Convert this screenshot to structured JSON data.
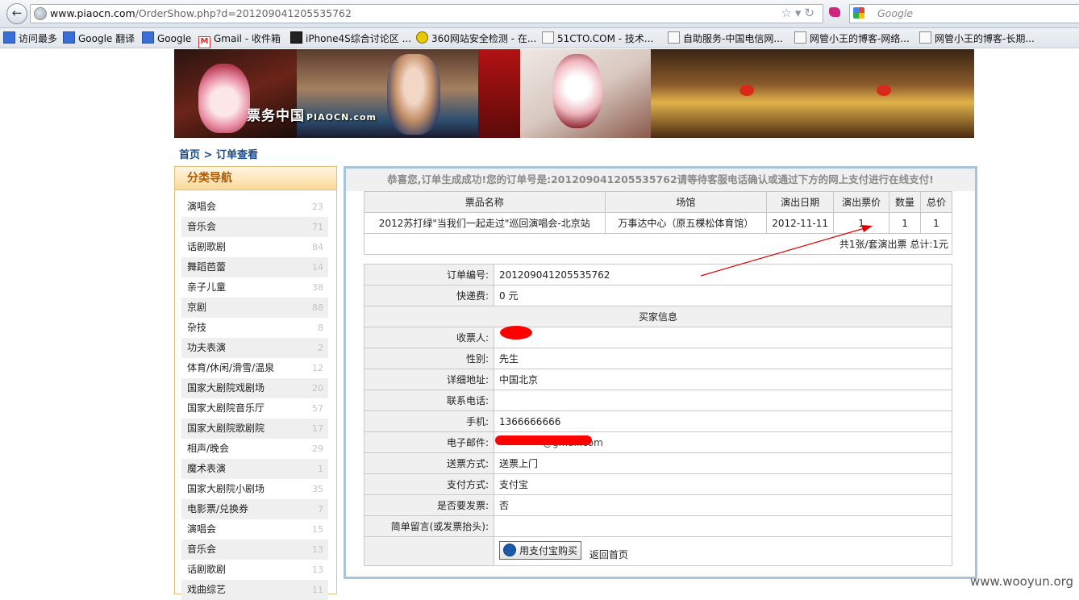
{
  "browser": {
    "url_prefix": "www.piaocn.com",
    "url_path": "/OrderShow.php?d=201209041205535762",
    "search_placeholder": "Google"
  },
  "bookmarks": [
    {
      "label": "访问最多"
    },
    {
      "label": "Google 翻译"
    },
    {
      "label": "Google"
    },
    {
      "label": "Gmail - 收件箱"
    },
    {
      "label": "iPhone4S综合讨论区 ..."
    },
    {
      "label": "360网站安全检测 - 在..."
    },
    {
      "label": "51CTO.COM - 技术..."
    },
    {
      "label": "自助服务-中国电信网..."
    },
    {
      "label": "网管小王的博客-网络..."
    },
    {
      "label": "网管小王的博客-长期..."
    }
  ],
  "banner": {
    "logo_text": "票务中国",
    "logo_sub": "PIAOCN.com"
  },
  "breadcrumb": {
    "home": "首页",
    "sep": " > ",
    "current": "订单查看"
  },
  "sidebar": {
    "title": "分类导航",
    "items": [
      {
        "label": "演唱会",
        "count": "23"
      },
      {
        "label": "音乐会",
        "count": "71"
      },
      {
        "label": "话剧歌剧",
        "count": "84"
      },
      {
        "label": "舞蹈芭蕾",
        "count": "14"
      },
      {
        "label": "亲子儿童",
        "count": "38"
      },
      {
        "label": "京剧",
        "count": "88"
      },
      {
        "label": "杂技",
        "count": "8"
      },
      {
        "label": "功夫表演",
        "count": "2"
      },
      {
        "label": "体育/休闲/滑雪/温泉",
        "count": "12"
      },
      {
        "label": "国家大剧院戏剧场",
        "count": "20"
      },
      {
        "label": "国家大剧院音乐厅",
        "count": "57"
      },
      {
        "label": "国家大剧院歌剧院",
        "count": "17"
      },
      {
        "label": "相声/晚会",
        "count": "29"
      },
      {
        "label": "魔术表演",
        "count": "1"
      },
      {
        "label": "国家大剧院小剧场",
        "count": "35"
      },
      {
        "label": "电影票/兑换券",
        "count": "7"
      },
      {
        "label": "演唱会",
        "count": "15"
      },
      {
        "label": "音乐会",
        "count": "13"
      },
      {
        "label": "话剧歌剧",
        "count": "13"
      },
      {
        "label": "戏曲综艺",
        "count": "11"
      }
    ]
  },
  "notice": "恭喜您,订单生成成功!您的订单号是:201209041205535762请等待客服电话确认或通过下方的网上支付进行在线支付!",
  "order_table": {
    "headers": [
      "票品名称",
      "场馆",
      "演出日期",
      "演出票价",
      "数量",
      "总价"
    ],
    "row": [
      "2012苏打绿\"当我们一起走过\"巡回演唱会-北京站",
      "万事达中心（原五棵松体育馆）",
      "2012-11-11",
      "1",
      "1",
      "1"
    ],
    "summary": "共1张/套演出票  总计:1元"
  },
  "details": {
    "order_no_label": "订单编号:",
    "order_no": "201209041205535762",
    "shipping_label": "快递费:",
    "shipping": "0 元",
    "buyer_section": "买家信息",
    "receiver_label": "收票人:",
    "receiver": "",
    "gender_label": "性别:",
    "gender": "先生",
    "address_label": "详细地址:",
    "address": "中国北京",
    "phone_label": "联系电话:",
    "phone": "",
    "mobile_label": "手机:",
    "mobile": "1366666666",
    "email_label": "电子邮件:",
    "email": "@gmail.com",
    "delivery_label": "送票方式:",
    "delivery": "送票上门",
    "payment_label": "支付方式:",
    "payment": "支付宝",
    "invoice_label": "是否要发票:",
    "invoice": "否",
    "note_label": "简单留言(或发票抬头):",
    "note": ""
  },
  "actions": {
    "pay_button": "用支付宝购买",
    "home_link": "返回首页"
  },
  "watermark": "www.wooyun.org"
}
